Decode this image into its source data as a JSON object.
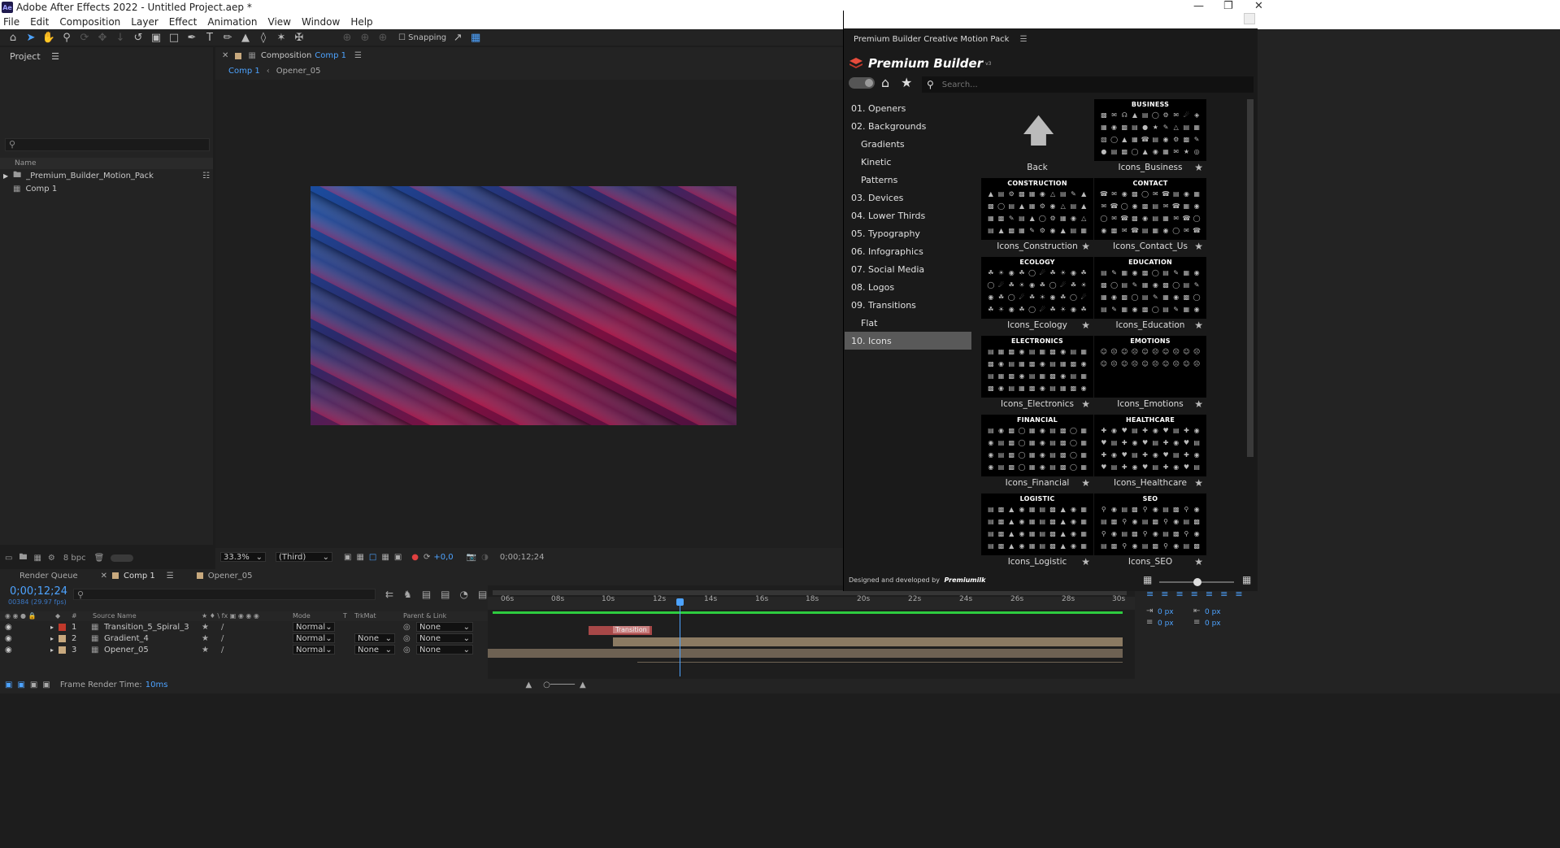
{
  "window": {
    "title": "Adobe After Effects 2022 - Untitled Project.aep *",
    "app_badge": "Ae"
  },
  "menu": [
    "File",
    "Edit",
    "Composition",
    "Layer",
    "Effect",
    "Animation",
    "View",
    "Window",
    "Help"
  ],
  "toolbar": {
    "snapping_label": "Snapping"
  },
  "project": {
    "title": "Project",
    "search_placeholder": "",
    "column_name": "Name",
    "items": [
      {
        "name": "_Premium_Builder_Motion_Pack",
        "type": "folder"
      },
      {
        "name": "Comp 1",
        "type": "comp"
      }
    ],
    "bpc": "8 bpc"
  },
  "composition": {
    "header_prefix": "Composition",
    "header_name": "Comp 1",
    "breadcrumbs": [
      "Comp 1",
      "Opener_05"
    ],
    "zoom": "33.3%",
    "resolution": "(Third)",
    "exposure": "+0,0",
    "timecode": "0;00;12;24"
  },
  "timeline": {
    "tabs": [
      "Render Queue",
      "Comp 1",
      "Opener_05"
    ],
    "timecode": "0;00;12;24",
    "frame_info": "00384 (29.97 fps)",
    "columns": {
      "source_name": "Source Name",
      "mode": "Mode",
      "t": "T",
      "trkmat": "TrkMat",
      "parent": "Parent & Link"
    },
    "layers": [
      {
        "num": "1",
        "name": "Transition_5_Spiral_3",
        "mode": "Normal",
        "trkmat": "",
        "parent": "None",
        "color": "#c0392b"
      },
      {
        "num": "2",
        "name": "Gradient_4",
        "mode": "Normal",
        "trkmat": "None",
        "parent": "None",
        "color": "#c8a97e"
      },
      {
        "num": "3",
        "name": "Opener_05",
        "mode": "Normal",
        "trkmat": "None",
        "parent": "None",
        "color": "#c8a97e"
      }
    ],
    "ruler": [
      "06s",
      "08s",
      "10s",
      "12s",
      "14s",
      "16s",
      "18s",
      "20s",
      "22s",
      "24s",
      "26s",
      "28s",
      "30s"
    ],
    "marker_label": "Transition",
    "render_time_label": "Frame Render Time:",
    "render_time_value": "10ms"
  },
  "right_panel": {
    "zero_a": "0 px",
    "zero_b": "0 px",
    "zero_c": "0 px",
    "zero_d": "0 px"
  },
  "plugin": {
    "panel_title": "Premium Builder Creative Motion Pack",
    "brand": "Premium Builder",
    "brand_sup": "v3",
    "search_placeholder": "Search...",
    "categories": [
      {
        "label": "01. Openers",
        "sub": false,
        "active": false
      },
      {
        "label": "02. Backgrounds",
        "sub": false,
        "active": false
      },
      {
        "label": "Gradients",
        "sub": true,
        "active": false
      },
      {
        "label": "Kinetic",
        "sub": true,
        "active": false
      },
      {
        "label": "Patterns",
        "sub": true,
        "active": false
      },
      {
        "label": "03. Devices",
        "sub": false,
        "active": false
      },
      {
        "label": "04. Lower Thirds",
        "sub": false,
        "active": false
      },
      {
        "label": "05. Typography",
        "sub": false,
        "active": false
      },
      {
        "label": "06. Infographics",
        "sub": false,
        "active": false
      },
      {
        "label": "07. Social Media",
        "sub": false,
        "active": false
      },
      {
        "label": "08. Logos",
        "sub": false,
        "active": false
      },
      {
        "label": "09. Transitions",
        "sub": false,
        "active": false
      },
      {
        "label": "Flat",
        "sub": true,
        "active": false
      },
      {
        "label": "10. Icons",
        "sub": false,
        "active": true
      }
    ],
    "back_label": "Back",
    "tiles": [
      {
        "title": "BUSINESS",
        "label": "Icons_Business"
      },
      {
        "title": "CONSTRUCTION",
        "label": "Icons_Construction"
      },
      {
        "title": "CONTACT",
        "label": "Icons_Contact_Us"
      },
      {
        "title": "ECOLOGY",
        "label": "Icons_Ecology"
      },
      {
        "title": "EDUCATION",
        "label": "Icons_Education"
      },
      {
        "title": "ELECTRONICS",
        "label": "Icons_Electronics"
      },
      {
        "title": "EMOTIONS",
        "label": "Icons_Emotions"
      },
      {
        "title": "FINANCIAL",
        "label": "Icons_Financial"
      },
      {
        "title": "HEALTHCARE",
        "label": "Icons_Healthcare"
      },
      {
        "title": "LOGISTIC",
        "label": "Icons_Logistic"
      },
      {
        "title": "SEO",
        "label": "Icons_SEO"
      }
    ],
    "footer": "Designed and developed by",
    "footer_brand": "Premiumilk"
  }
}
